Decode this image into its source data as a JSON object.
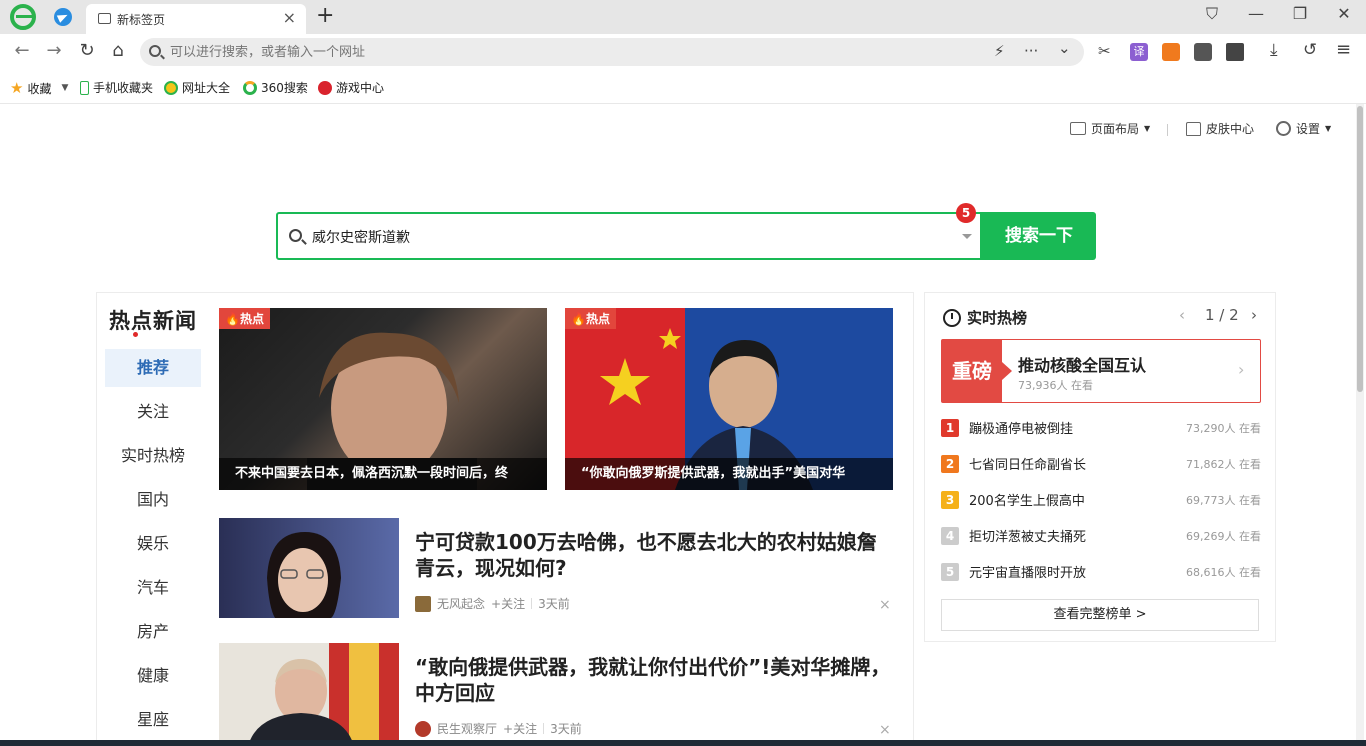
{
  "browser": {
    "tab_title": "新标签页",
    "tab_close": "×",
    "new_tab": "+",
    "window": {
      "shirt": "⛉",
      "minimize": "—",
      "restore": "❐",
      "close": "✕"
    }
  },
  "navbar": {
    "back": "←",
    "forward": "→",
    "reload": "↻",
    "home": "⌂",
    "address_placeholder": "可以进行搜索，或者输入一个网址",
    "flash": "⚡",
    "more": "···",
    "dropdown": "⌄",
    "cut": "✂",
    "translate": "译",
    "download": "⤓",
    "undo": "↺",
    "menu": "≡"
  },
  "bookmarks": {
    "items": [
      {
        "label": "收藏",
        "icon": "star-icon",
        "color": "#f5a623"
      },
      {
        "label": "手机收藏夹",
        "icon": "phone-icon",
        "color": "#2bb24c"
      },
      {
        "label": "网址大全",
        "icon": "globe-icon",
        "color": "#f5c518"
      },
      {
        "label": "360搜索",
        "icon": "360-icon",
        "color": "#2bb24c"
      },
      {
        "label": "游戏中心",
        "icon": "game-icon",
        "color": "#d9232d"
      }
    ]
  },
  "page": {
    "top_links": {
      "layout": "页面布局",
      "skin": "皮肤中心",
      "settings": "设置"
    },
    "search": {
      "value": "威尔史密斯道歉",
      "badge": "5",
      "button": "搜索一下"
    },
    "news": {
      "title": "热点新闻",
      "categories": [
        "推荐",
        "关注",
        "实时热榜",
        "国内",
        "娱乐",
        "汽车",
        "房产",
        "健康",
        "星座"
      ],
      "heroes": [
        {
          "tag": "🔥热点",
          "caption": "不来中国要去日本，佩洛西沉默一段时间后，终"
        },
        {
          "tag": "🔥热点",
          "caption": "“你敢向俄罗斯提供武器，我就出手”美国对华"
        }
      ],
      "articles": [
        {
          "title": "宁可贷款100万去哈佛，也不愿去北大的农村姑娘詹青云，现况如何?",
          "source": "无风起念",
          "follow": "+关注",
          "time": "3天前",
          "close": "×"
        },
        {
          "title": "“敢向俄提供武器，我就让你付出代价”!美对华摊牌，中方回应",
          "source": "民生观察厅",
          "follow": "+关注",
          "time": "3天前",
          "close": "×"
        }
      ]
    },
    "hot": {
      "title": "实时热榜",
      "pager": "1 / 2",
      "prev": "‹",
      "next": "›",
      "featured": {
        "tag": "重磅",
        "title": "推动核酸全国互认",
        "views": "73,936人 在看",
        "arrow": "›"
      },
      "items": [
        {
          "rank": "1",
          "text": "蹦极通停电被倒挂",
          "views": "73,290人 在看",
          "color": "#e0392c"
        },
        {
          "rank": "2",
          "text": "七省同日任命副省长",
          "views": "71,862人 在看",
          "color": "#f0781e"
        },
        {
          "rank": "3",
          "text": "200名学生上假高中",
          "views": "69,773人 在看",
          "color": "#f5b11a"
        },
        {
          "rank": "4",
          "text": "拒切洋葱被丈夫捅死",
          "views": "69,269人 在看",
          "color": "#cccccc"
        },
        {
          "rank": "5",
          "text": "元宇宙直播限时开放",
          "views": "68,616人 在看",
          "color": "#cccccc"
        }
      ],
      "full_list": "查看完整榜单 >"
    }
  }
}
